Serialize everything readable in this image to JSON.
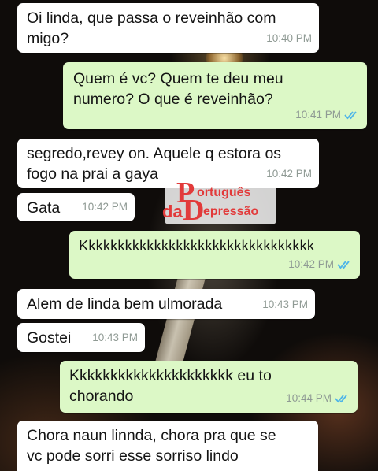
{
  "conversation": {
    "messages": [
      {
        "direction": "incoming",
        "text": "Oi linda, que passa o reveinhão com\nmigo?",
        "time": "10:40 PM"
      },
      {
        "direction": "outgoing",
        "text": "Quem é vc? Quem te deu meu\nnumero? O que é reveinhão?",
        "time": "10:41 PM",
        "status_icon": "double-check-read"
      },
      {
        "direction": "incoming",
        "text": "segredo,revey on. Aquele q estora os\nfogo na prai a gaya",
        "time": "10:42 PM"
      },
      {
        "direction": "incoming",
        "text": "Gata",
        "time": "10:42 PM"
      },
      {
        "direction": "outgoing",
        "text": "Kkkkkkkkkkkkkkkkkkkkkkkkkkkkkkkk",
        "time": "10:42 PM",
        "status_icon": "double-check-read"
      },
      {
        "direction": "incoming",
        "text": "Alem de linda bem ulmorada",
        "time": "10:43 PM"
      },
      {
        "direction": "incoming",
        "text": "Gostei",
        "time": "10:43 PM"
      },
      {
        "direction": "outgoing",
        "text": "Kkkkkkkkkkkkkkkkkkkkk eu to\nchorando",
        "time": "10:44 PM",
        "status_icon": "double-check-read"
      },
      {
        "direction": "incoming",
        "text": "Chora naun linnda, chora pra que se\nvc pode sorri esse sorriso lindo",
        "time": ""
      }
    ]
  },
  "watermark": {
    "letter_p": "P",
    "word_1": "ortuguês",
    "word_da": "da",
    "letter_d": "D",
    "word_2": "epressão"
  },
  "colors": {
    "incoming_bubble": "#ffffff",
    "outgoing_bubble": "#dcf8c6",
    "read_ticks": "#4fb5e8",
    "watermark": "#e23a3a"
  }
}
